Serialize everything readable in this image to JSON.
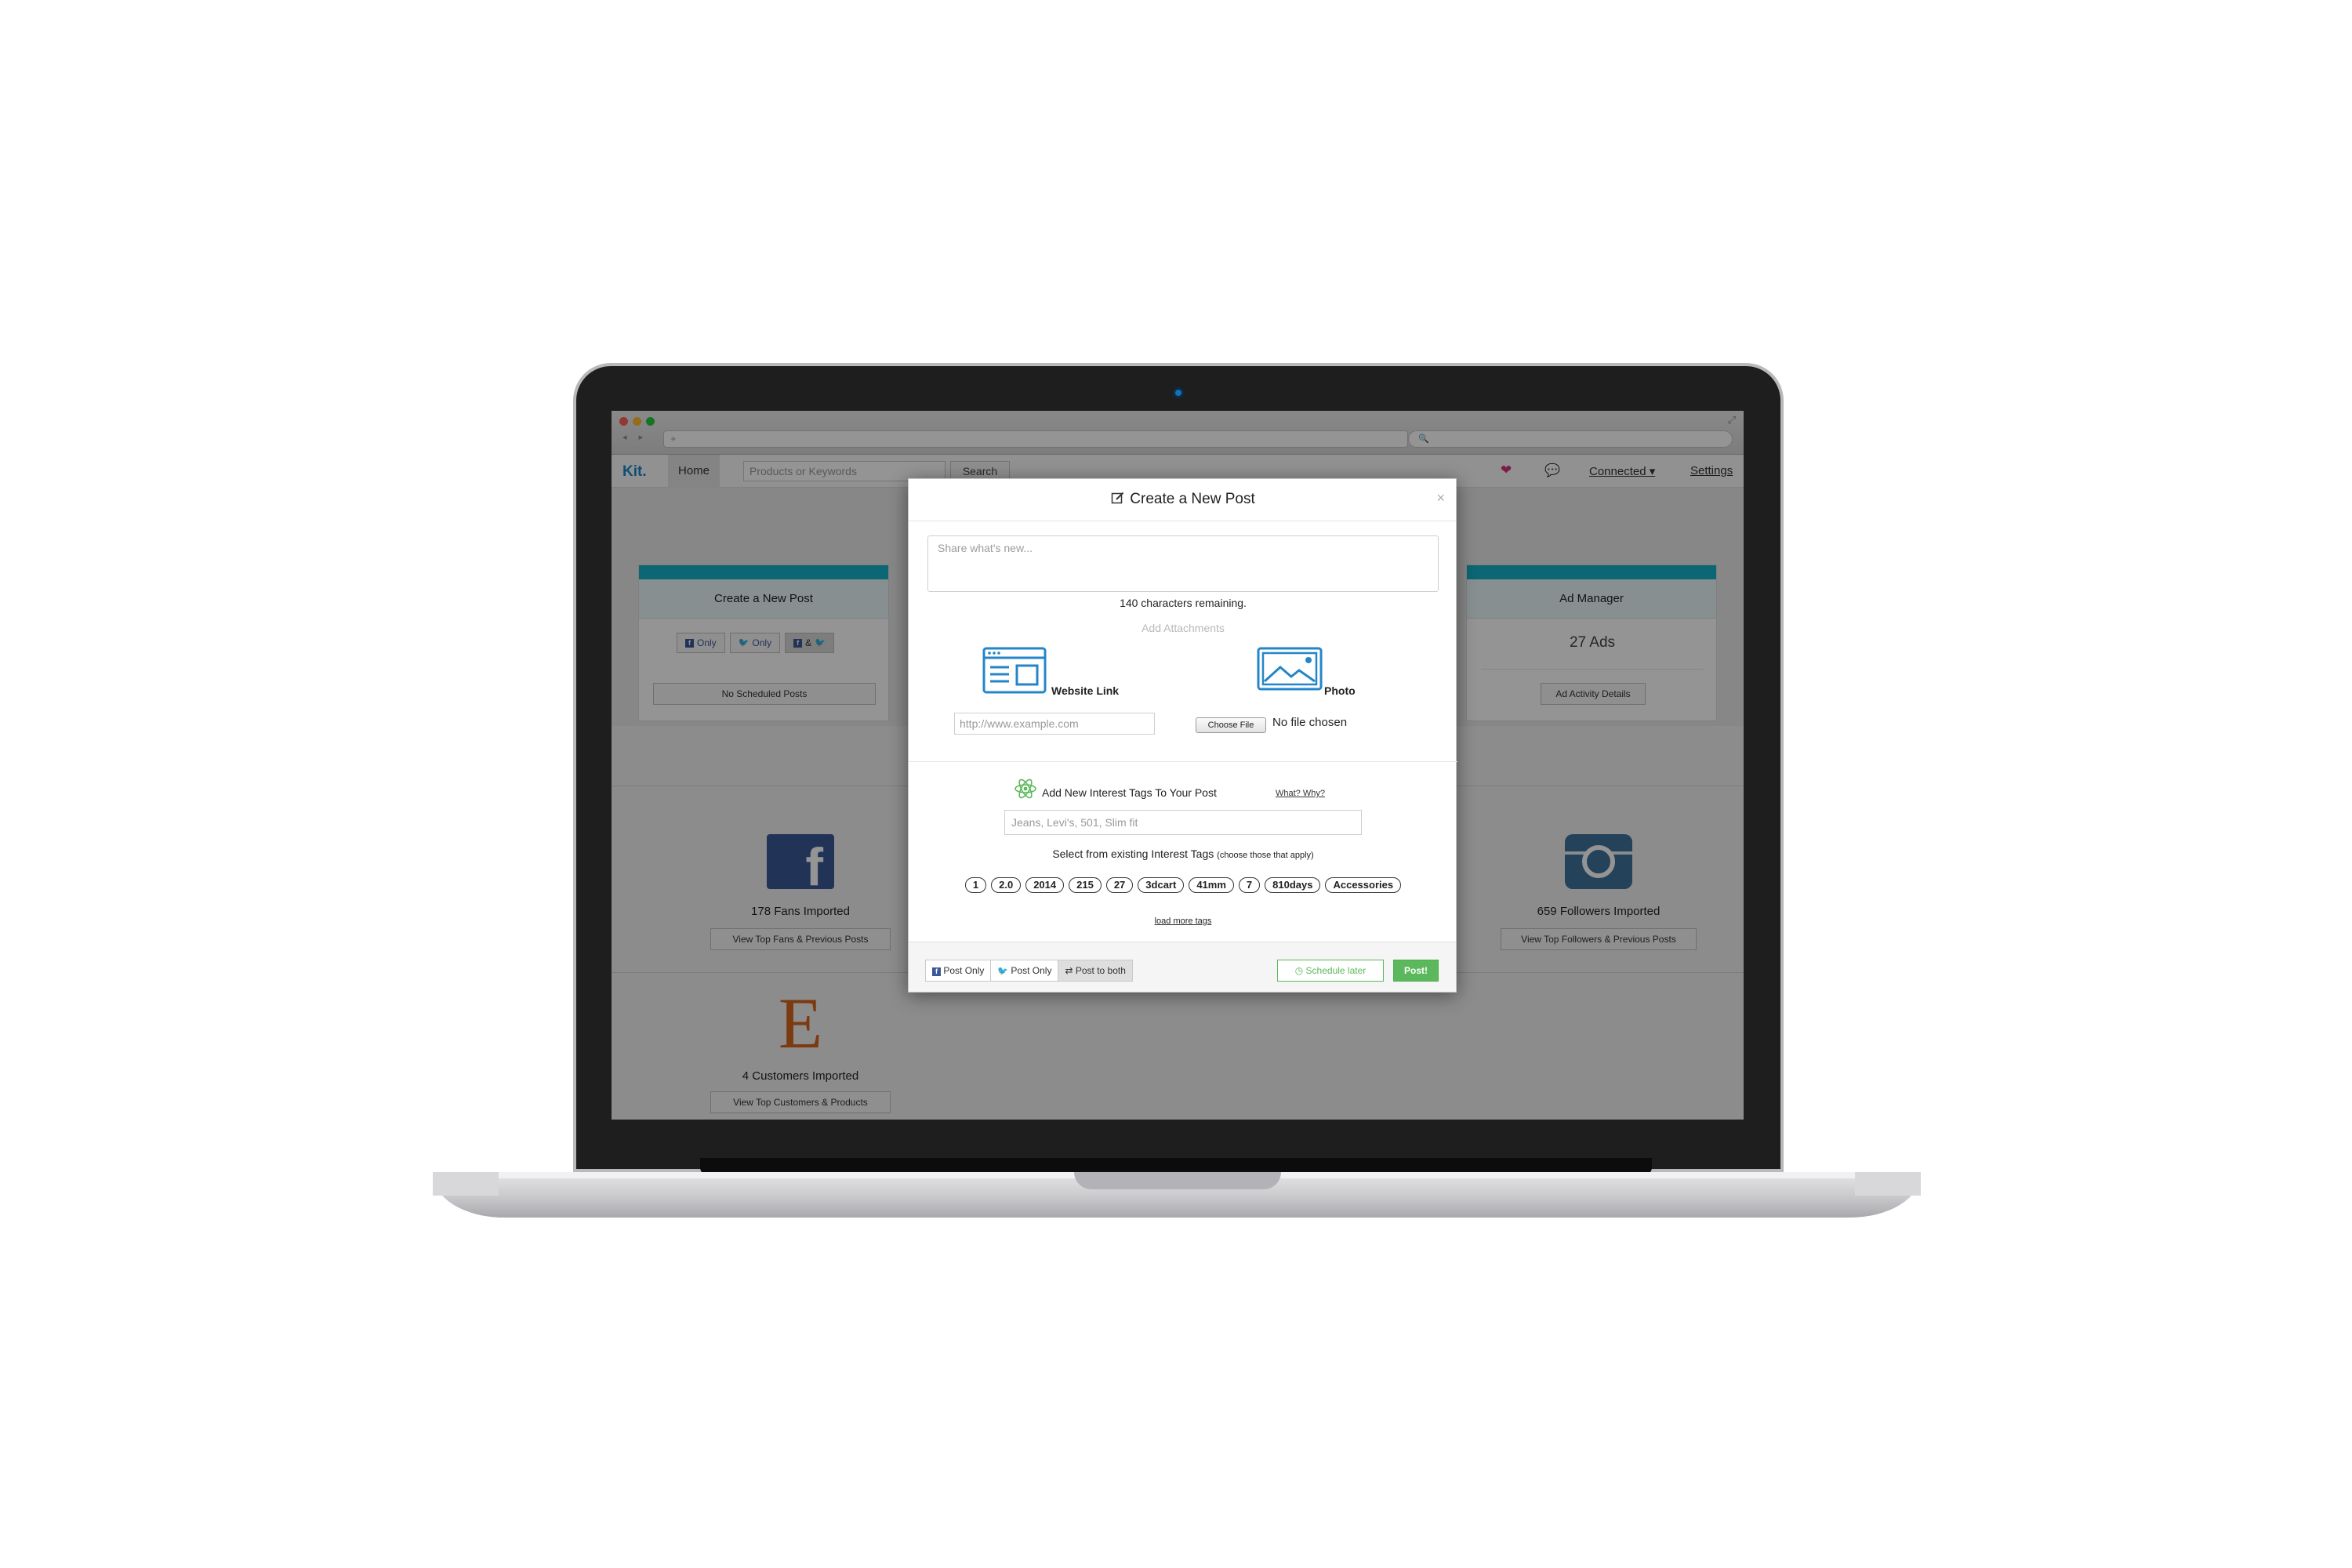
{
  "browser": {
    "nav_arrows": "◂ ▸",
    "url_value": "+",
    "search_glyph": "🔍",
    "expand_glyph": "⤢"
  },
  "app": {
    "logo": "Kit.",
    "nav": {
      "home": "Home",
      "search_placeholder": "Products or Keywords",
      "search_button": "Search",
      "connected": "Connected ▾",
      "settings": "Settings",
      "heart_icon": "heart-icon",
      "chat_icon": "chat-icon"
    },
    "cards": {
      "create_post": {
        "title": "Create a New Post",
        "fb_only": "Only",
        "tw_only": "Only",
        "both": "&",
        "scheduled": "No Scheduled Posts"
      },
      "ad_manager": {
        "title": "Ad Manager",
        "count": "27 Ads",
        "details": "Ad Activity Details"
      }
    },
    "social": {
      "facebook": {
        "label": "178 Fans Imported",
        "button": "View Top Fans & Previous Posts",
        "glyph": "f"
      },
      "instagram": {
        "label": "659 Followers Imported",
        "button": "View Top Followers & Previous Posts"
      },
      "etsy": {
        "label": "4 Customers Imported",
        "button": "View Top Customers & Products",
        "glyph": "E"
      }
    }
  },
  "modal": {
    "title": "Create a New Post",
    "close": "×",
    "share_placeholder": "Share what's new...",
    "chars_remaining": "140 characters remaining.",
    "attachments_title": "Add Attachments",
    "website_link_label": "Website Link",
    "url_placeholder": "http://www.example.com",
    "photo_label": "Photo",
    "choose_file": "Choose File",
    "no_file": "No file chosen",
    "tags_heading": "Add New Interest Tags To Your Post",
    "what_why": "What? Why?",
    "tags_placeholder": "Jeans, Levi's, 501, Slim fit",
    "select_tags": "Select from existing Interest Tags",
    "select_tags_note": "(choose those that apply)",
    "tags": [
      "1",
      "2.0",
      "2014",
      "215",
      "27",
      "3dcart",
      "41mm",
      "7",
      "810days",
      "Accessories"
    ],
    "load_more": "load more tags",
    "footer": {
      "fb_post_only": "Post Only",
      "tw_post_only": "Post Only",
      "post_both": "Post to both",
      "schedule_later": "Schedule later",
      "post": "Post!"
    }
  },
  "colors": {
    "brand_blue": "#1a88c9",
    "accent_teal": "#12b1c6",
    "success_green": "#5cb85c",
    "facebook": "#3b5998",
    "twitter": "#1da1f2",
    "etsy": "#d5641c",
    "icon_blue": "#2486c8"
  }
}
